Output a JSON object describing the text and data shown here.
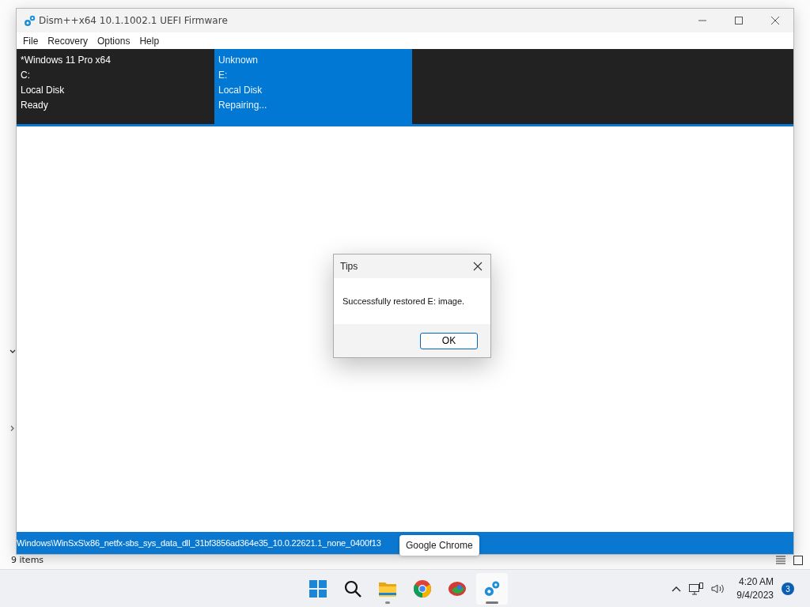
{
  "window": {
    "title": "Dism++x64 10.1.1002.1 UEFI Firmware"
  },
  "menu": [
    "File",
    "Recovery",
    "Options",
    "Help"
  ],
  "sessions": [
    {
      "lines": [
        "*Windows 11 Pro x64",
        "C:",
        "Local Disk",
        "Ready"
      ],
      "selected": false
    },
    {
      "lines": [
        "Unknown",
        "E:",
        "Local Disk",
        "Repairing..."
      ],
      "selected": true
    }
  ],
  "status_bar": {
    "path": "Windows\\WinSxS\\x86_netfx-sbs_sys_data_dll_31bf3856ad364e35_10.0.22621.1_none_0400f13"
  },
  "dialog": {
    "title": "Tips",
    "message": "Successfully restored E: image.",
    "buttons": [
      "OK"
    ]
  },
  "tooltip": "Google Chrome",
  "background_window": {
    "status": "9 items"
  },
  "taskbar": {
    "apps": [
      {
        "kind": "start",
        "running": false,
        "active": false
      },
      {
        "kind": "search",
        "running": false,
        "active": false
      },
      {
        "kind": "folder",
        "running": true,
        "active": false
      },
      {
        "kind": "chrome",
        "running": false,
        "active": false
      },
      {
        "kind": "app",
        "running": false,
        "active": false
      },
      {
        "kind": "gear",
        "running": true,
        "active": true
      }
    ],
    "time": "4:20 AM",
    "date": "9/4/2023",
    "notification_count": "3"
  }
}
